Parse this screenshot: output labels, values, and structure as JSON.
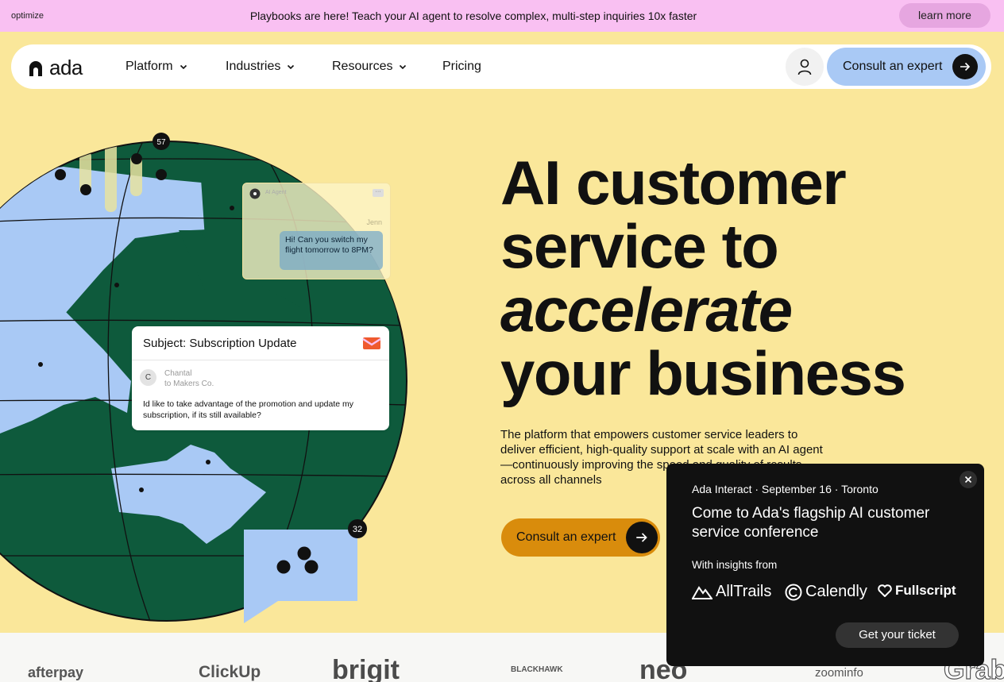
{
  "banner": {
    "left_text": "optimize",
    "message": "Playbooks are here! Teach your AI agent to resolve complex, multi-step inquiries 10x faster",
    "learn_more": "learn more"
  },
  "nav": {
    "logo_text": "ada",
    "items": [
      {
        "label": "Platform",
        "icon": "chevron-down-icon"
      },
      {
        "label": "Industries",
        "icon": "chevron-down-icon"
      },
      {
        "label": "Resources",
        "icon": "chevron-down-icon"
      },
      {
        "label": "Pricing"
      }
    ],
    "cta": "Consult an expert"
  },
  "illustration": {
    "badge_top": "57",
    "badge_bottom": "32",
    "chat": {
      "header": "AI Agent",
      "from": "Jenn",
      "message": "Hi! Can you switch my flight tomorrow to 8PM?"
    },
    "mail": {
      "subject": "Subject: Subscription Update",
      "avatar_initial": "C",
      "sender": "Chantal",
      "recipient": "to Makers Co.",
      "body": "Id like to take advantage of the promotion and update my subscription, if its still available?"
    }
  },
  "hero": {
    "line1": "AI customer",
    "line2": "service to",
    "line3": "accelerate",
    "line4": "your business",
    "subtitle": "The platform that empowers customer service leaders to deliver efficient, high-quality support at scale with an AI agent—continuously improving the speed and quality of results across all channels",
    "cta": "Consult an expert"
  },
  "popup": {
    "event": "Ada Interact · September 16 · Toronto",
    "headline": "Come to Ada's flagship AI customer service conference",
    "insights_label": "With insights from",
    "brands": [
      "AllTrails",
      "Calendly",
      "Fullscript"
    ],
    "ticket_button": "Get your ticket"
  },
  "logos": [
    "afterpay",
    "ClickUp",
    "brigit",
    "BLACKHAWK",
    "neo",
    "zoominfo",
    "Grab"
  ],
  "colors": {
    "background": "#fae79a",
    "banner": "#f9c0f2",
    "nav_cta": "#a9c9f5",
    "hero_cta": "#d98c0c",
    "globe_green": "#0e5a3c",
    "globe_blue": "#a9c9f5"
  }
}
